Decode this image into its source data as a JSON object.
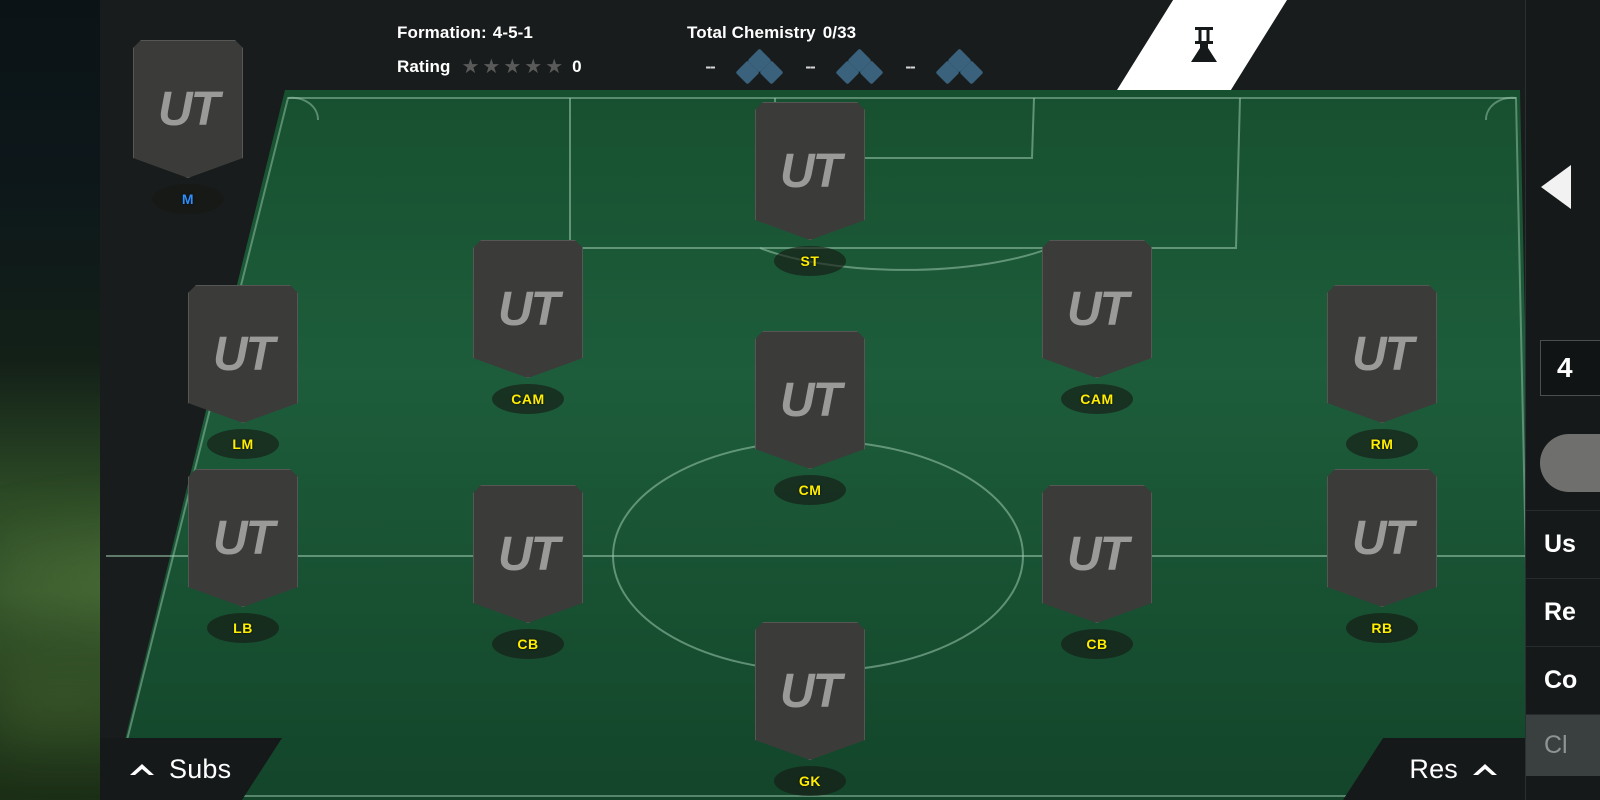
{
  "header": {
    "formation_label": "Formation:",
    "formation_value": "4-5-1",
    "rating_label": "Rating",
    "rating_value": "0",
    "stars": [
      "★",
      "★",
      "★",
      "★",
      "★"
    ],
    "chemistry_label": "Total Chemistry",
    "chemistry_value": "0/33",
    "chemistry_groups": [
      {
        "dash": "--"
      },
      {
        "dash": "--"
      },
      {
        "dash": "--"
      }
    ]
  },
  "chem_tab": {
    "icon": "flask-icon"
  },
  "pitch": {
    "players": [
      {
        "position": "M",
        "badge_color": "#2f8fff",
        "logo": "UT",
        "type": "manager"
      },
      {
        "position": "ST",
        "badge_color": "#ffee00",
        "logo": "UT",
        "type": "player"
      },
      {
        "position": "CAM",
        "badge_color": "#ffee00",
        "logo": "UT",
        "type": "player"
      },
      {
        "position": "CAM",
        "badge_color": "#ffee00",
        "logo": "UT",
        "type": "player"
      },
      {
        "position": "LM",
        "badge_color": "#ffee00",
        "logo": "UT",
        "type": "player"
      },
      {
        "position": "RM",
        "badge_color": "#ffee00",
        "logo": "UT",
        "type": "player"
      },
      {
        "position": "CM",
        "badge_color": "#ffee00",
        "logo": "UT",
        "type": "player"
      },
      {
        "position": "LB",
        "badge_color": "#ffee00",
        "logo": "UT",
        "type": "player"
      },
      {
        "position": "CB",
        "badge_color": "#ffee00",
        "logo": "UT",
        "type": "player"
      },
      {
        "position": "CB",
        "badge_color": "#ffee00",
        "logo": "UT",
        "type": "player"
      },
      {
        "position": "RB",
        "badge_color": "#ffee00",
        "logo": "UT",
        "type": "player"
      },
      {
        "position": "GK",
        "badge_color": "#ffee00",
        "logo": "UT",
        "type": "player"
      }
    ]
  },
  "bottom": {
    "subs_label": "Subs",
    "reserves_label": "Res"
  },
  "sidebar": {
    "counter_value": "4",
    "items": [
      {
        "label": "Us"
      },
      {
        "label": "Re"
      },
      {
        "label": "Co"
      },
      {
        "label": "Cl"
      }
    ]
  },
  "colors": {
    "pitch_green": "#1c5135",
    "panel_dark": "#181c1c",
    "badge_yellow": "#ffee00",
    "manager_blue": "#2f8fff",
    "chem_diamond": "#3a627d"
  }
}
